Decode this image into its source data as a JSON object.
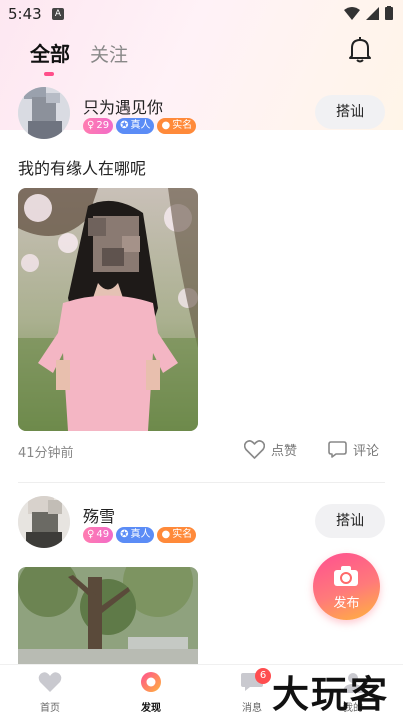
{
  "status": {
    "time": "5:43",
    "notif_letter": "A"
  },
  "tabs": [
    {
      "label": "全部",
      "active": true
    },
    {
      "label": "关注",
      "active": false
    }
  ],
  "posts": [
    {
      "username": "只为遇见你",
      "badges": {
        "num": "29",
        "real": "真人",
        "name": "实名"
      },
      "chat_label": "搭讪",
      "text": "我的有缘人在哪呢",
      "time": "41分钟前",
      "like_label": "点赞",
      "comment_label": "评论"
    },
    {
      "username": "殇雪",
      "badges": {
        "num": "49",
        "real": "真人",
        "name": "实名"
      },
      "chat_label": "搭讪"
    }
  ],
  "publish_label": "发布",
  "nav": [
    {
      "label": "首页",
      "icon": "heart-icon"
    },
    {
      "label": "发现",
      "icon": "discover-icon"
    },
    {
      "label": "消息",
      "icon": "message-icon",
      "badge": "6"
    },
    {
      "label": "我的",
      "icon": "profile-icon"
    }
  ],
  "watermark": "大玩客",
  "colors": {
    "accent": "#ff4f8a",
    "real_badge": "#5b8cf6",
    "name_badge": "#ff8a3a"
  }
}
